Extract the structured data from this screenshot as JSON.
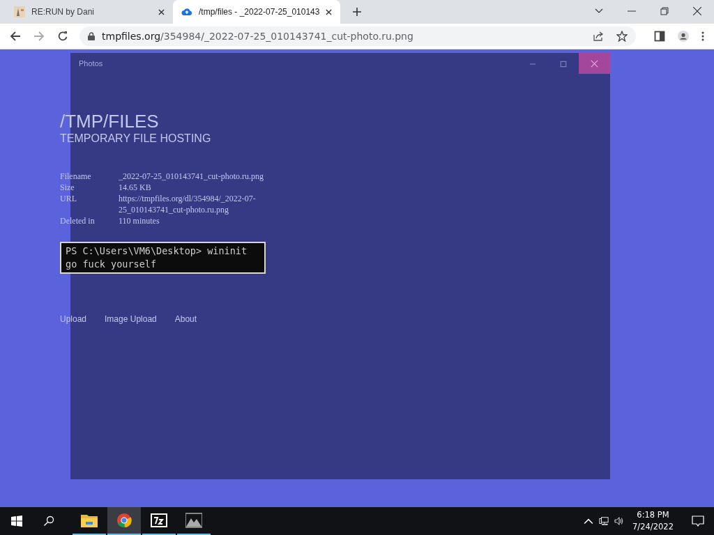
{
  "browser": {
    "tabs": [
      {
        "title": "RE:RUN by Dani",
        "kind": "game",
        "selected": false
      },
      {
        "title": "/tmp/files - _2022-07-25_010143",
        "kind": "cloud",
        "selected": true
      }
    ],
    "url_host": "tmpfiles.org",
    "url_path": "/354984/_2022-07-25_010143741_cut-photo.ru.png"
  },
  "page": {
    "title": "/TMP/FILES",
    "subtitle": "TEMPORARY FILE HOSTING",
    "details": [
      {
        "label": "Filename",
        "value": "_2022-07-25_010143741_cut-photo.ru.png"
      },
      {
        "label": "Size",
        "value": "14.65 KB"
      },
      {
        "label": "URL",
        "value": "https://tmpfiles.org/dl/354984/_2022-07-25_010143741_cut-photo.ru.png"
      },
      {
        "label": "Deleted in",
        "value": "110 minutes"
      }
    ],
    "terminal": [
      "PS C:\\Users\\VM6\\Desktop> wininit",
      "go fuck yourself"
    ],
    "nav": [
      "Upload",
      "Image Upload",
      "About"
    ]
  },
  "photos_window": {
    "title": "Photos"
  },
  "taskbar": {
    "apps": [
      {
        "kind": "folder",
        "active": false
      },
      {
        "kind": "chrome",
        "active": true
      },
      {
        "kind": "zip",
        "active": false
      },
      {
        "kind": "photos",
        "active": false
      }
    ],
    "time": "6:18 PM",
    "date": "7/24/2022"
  }
}
